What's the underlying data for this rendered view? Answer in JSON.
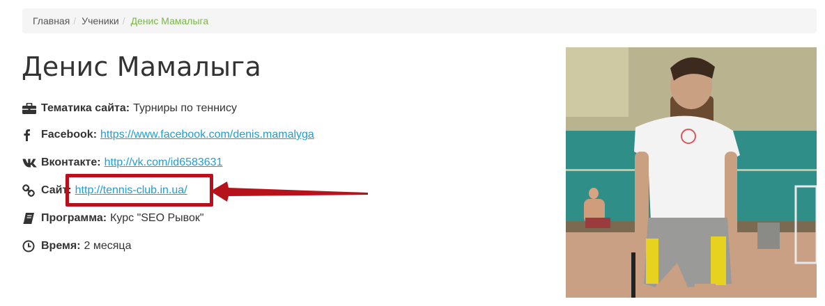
{
  "breadcrumb": {
    "home": "Главная",
    "students": "Ученики",
    "current": "Денис Мамалыга",
    "separator": "/"
  },
  "profile": {
    "name": "Денис Мамалыга",
    "topic_label": "Тематика сайта:",
    "topic_value": "Турниры по теннису",
    "facebook_label": "Facebook:",
    "facebook_url": "https://www.facebook.com/denis.mamalyga",
    "vk_label": "Вконтакте:",
    "vk_url": "http://vk.com/id6583631",
    "site_label": "Сайт:",
    "site_url": "http://tennis-club.in.ua/",
    "program_label": "Программа:",
    "program_value": "Курс \"SEO Рывок\"",
    "time_label": "Время:",
    "time_value": "2 месяца"
  },
  "icons": {
    "topic": "briefcase-icon",
    "facebook": "facebook-icon",
    "vk": "vk-icon",
    "site": "link-icon",
    "program": "book-icon",
    "time": "clock-icon"
  },
  "colors": {
    "link": "#1a9fd6",
    "breadcrumb_active": "#7ab648",
    "highlight": "#b5121b"
  }
}
